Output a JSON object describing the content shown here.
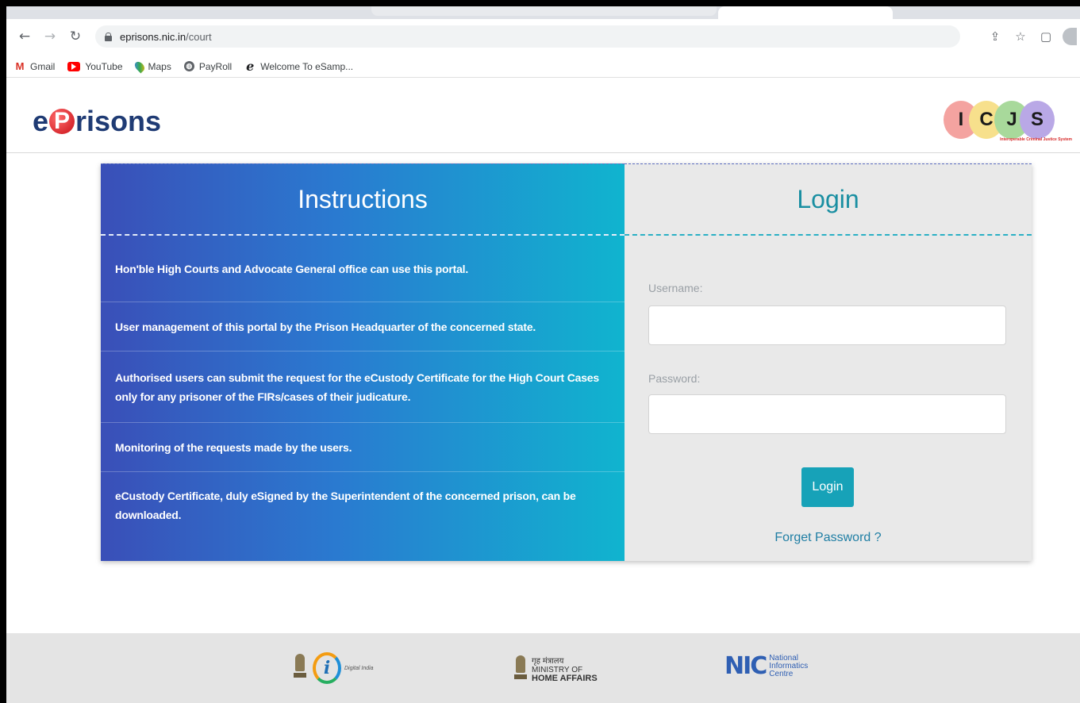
{
  "browser": {
    "url_host": "eprisons.nic.in",
    "url_path": "/court",
    "bookmarks": [
      {
        "label": "Gmail"
      },
      {
        "label": "YouTube"
      },
      {
        "label": "Maps"
      },
      {
        "label": "PayRoll"
      },
      {
        "label": "Welcome To eSamp..."
      }
    ]
  },
  "header": {
    "logo_prefix": "e",
    "logo_p": "P",
    "logo_suffix": "risons",
    "partner_letters": [
      "I",
      "C",
      "J",
      "S"
    ],
    "partner_caption": "Interoperable Criminal Justice System",
    "partner_colors": [
      "#f4a3a0",
      "#f7e08c",
      "#a8d99b",
      "#b9a8e6"
    ]
  },
  "instructions": {
    "title": "Instructions",
    "items": [
      "Hon'ble High Courts and Advocate General office can use this portal.",
      "User management of this portal by the Prison Headquarter of the concerned state.",
      "Authorised users can submit the request for the eCustody Certificate for the High Court Cases only for any prisoner of the FIRs/cases of their judicature.",
      "Monitoring of the requests made by the users.",
      "eCustody Certificate, duly eSigned by the Superintendent of the concerned prison, can be downloaded."
    ]
  },
  "login": {
    "title": "Login",
    "username_label": "Username:",
    "username_value": "",
    "password_label": "Password:",
    "password_value": "",
    "button_label": "Login",
    "forget_label": "Forget Password ?"
  },
  "footer": {
    "digital_india": "Digital India",
    "mha_hindi": "गृह मंत्रालय",
    "mha_line1": "MINISTRY OF",
    "mha_line2": "HOME AFFAIRS",
    "nic_letters": "NIC",
    "nic_line1": "National",
    "nic_line2": "Informatics",
    "nic_line3": "Centre"
  },
  "colors": {
    "instructions_gradient_start": "#3a4fb8",
    "instructions_gradient_end": "#10b4cf",
    "login_accent": "#17a2b8",
    "logo_blue": "#1f3b74",
    "logo_red": "#c80f17"
  }
}
